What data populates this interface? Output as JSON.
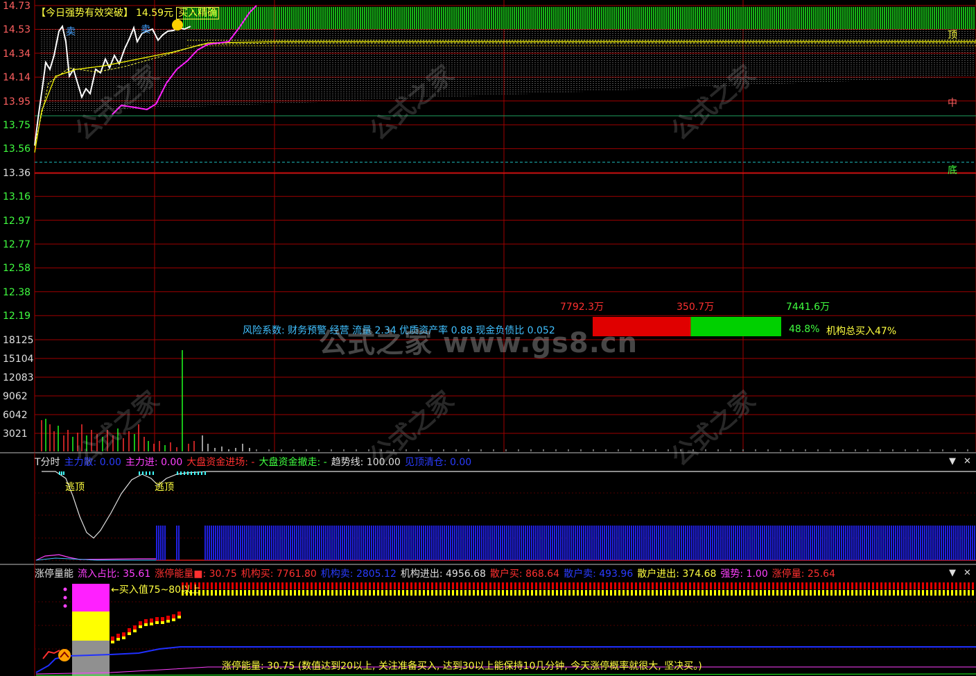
{
  "price_axis": [
    "14.73",
    "14.53",
    "14.34",
    "14.14",
    "13.95",
    "13.75",
    "13.56",
    "13.36",
    "13.16",
    "12.97",
    "12.77",
    "12.58",
    "12.38",
    "12.19"
  ],
  "volume_axis": [
    "18125",
    "15104",
    "12083",
    "9062",
    "6042",
    "3021"
  ],
  "main_header": {
    "signal": "【今日强势有效突破】",
    "price": "14.59",
    "unit": "元",
    "tag": "买入精确"
  },
  "markers": {
    "sell1": "卖",
    "sell2": "卖",
    "top": "顶",
    "mid": "中",
    "bottom": "底"
  },
  "funds": {
    "left_value": "7792.3万",
    "mid_value": "350.7万",
    "right_value": "7441.6万",
    "risk_text": "风险系数: 财务预警 经营 流量 2.34 优质资产率 0.88 现金负债比 0.052",
    "pct": "48.8%",
    "inst_total": "机构总买入47%",
    "red_frac": 0.52,
    "green_frac": 0.48
  },
  "t_panel": {
    "name": "T分时",
    "items": [
      {
        "label": "主力散: 0.00",
        "color": "#2a3cff"
      },
      {
        "label": "主力进: 0.00",
        "color": "#ff40ff"
      },
      {
        "label": "大盘资金进场: -",
        "color": "#ff3030"
      },
      {
        "label": "大盘资金撤走: -",
        "color": "#40ff40"
      },
      {
        "label": "趋势线: 100.00",
        "color": "#e0e0e0"
      },
      {
        "label": "见顶清仓: 0.00",
        "color": "#2a3cff"
      }
    ],
    "escape1": "逃顶",
    "escape2": "逃顶"
  },
  "zt_panel": {
    "name": "涨停量能",
    "items": [
      {
        "label": "流入占比: 35.61",
        "color": "#ff40ff"
      },
      {
        "label": "涨停能量■: 30.75",
        "color": "#ff3030"
      },
      {
        "label": "机构买: 7761.80",
        "color": "#ff3030"
      },
      {
        "label": "机构卖: 2805.12",
        "color": "#2a3cff"
      },
      {
        "label": "机构进出: 4956.68",
        "color": "#e0e0e0"
      },
      {
        "label": "散户买: 868.64",
        "color": "#ff3030"
      },
      {
        "label": "散户卖: 493.96",
        "color": "#2a3cff"
      },
      {
        "label": "散户进出: 374.68",
        "color": "#ffff40"
      },
      {
        "label": "强势: 1.00",
        "color": "#ff40ff"
      },
      {
        "label": "涨停量: 25.64",
        "color": "#ff3030"
      }
    ],
    "buy_hint": "←买入值75~80以上",
    "footer": "涨停能量: 30.75 (数值达到20以上, 关注准备买入, 达到30以上能保持10几分钟, 今天涨停概率就很大, 坚决买。)"
  },
  "watermark": {
    "big": "公式之家 www.gs8.cn",
    "small": "公式之家",
    "url": "www.gs8.cn"
  },
  "controls": {
    "dropdown": "▼",
    "close": "✕"
  },
  "colors": {
    "grid": "#a00000",
    "price_line": "#ffffff",
    "avg_line": "#ffff00",
    "pink_line": "#ff20ff",
    "bar_green": "#20ff20",
    "blue_bar": "#2020e0"
  }
}
